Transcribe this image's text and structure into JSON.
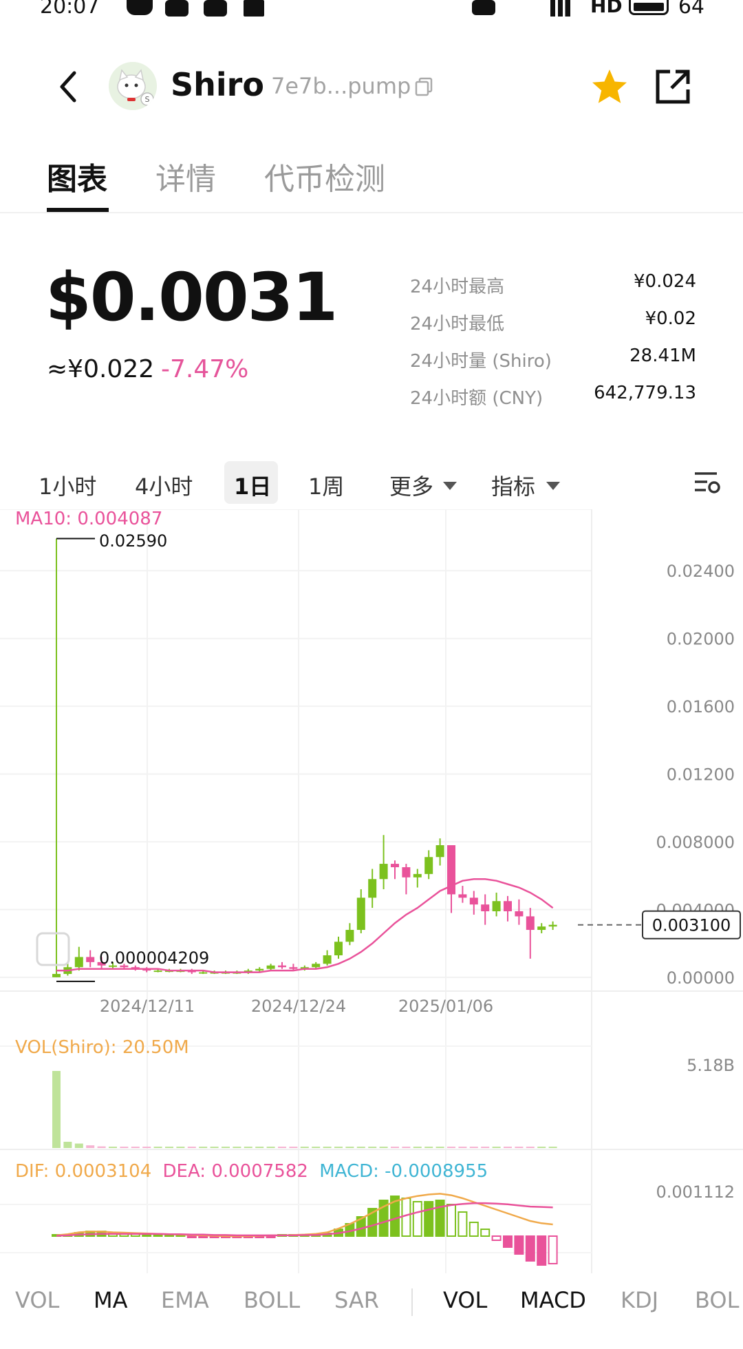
{
  "status_bar": {
    "time": "20:07",
    "network": "HD",
    "battery": "64"
  },
  "header": {
    "token_name": "Shiro",
    "token_address": "7e7b...pump"
  },
  "tabs": [
    {
      "label": "图表"
    },
    {
      "label": "详情"
    },
    {
      "label": "代币检测"
    }
  ],
  "price": {
    "usd": "$0.0031",
    "cny": "≈¥0.022",
    "change": "-7.47%",
    "stats": [
      {
        "label": "24小时最高",
        "value": "¥0.024"
      },
      {
        "label": "24小时最低",
        "value": "¥0.02"
      },
      {
        "label": "24小时量 (Shiro)",
        "value": "28.41M"
      },
      {
        "label": "24小时额 (CNY)",
        "value": "642,779.13"
      }
    ]
  },
  "timeframes": {
    "items": [
      "1小时",
      "4小时",
      "1日",
      "1周"
    ],
    "active": "1日",
    "more": "更多",
    "indicators": "指标"
  },
  "colors": {
    "up": "#7cc11e",
    "down": "#e9529a",
    "ma": "#e9529a",
    "dif": "#f0a94a",
    "macd": "#3fb5d4",
    "accent_star": "#f7b500"
  },
  "main_chart": {
    "ma_label": "MA10: 0.004087",
    "high_label": "0.02590",
    "low_label": "0.000004209",
    "current_label": "0.003100",
    "y_ticks": [
      "0.02400",
      "0.02000",
      "0.01600",
      "0.01200",
      "0.008000",
      "0.004000",
      "0.00000"
    ],
    "x_ticks": [
      "2024/12/11",
      "2024/12/24",
      "2025/01/06"
    ]
  },
  "vol_chart": {
    "label": "VOL(Shiro): 20.50M",
    "max_label": "5.18B"
  },
  "macd_chart": {
    "dif": "DIF: 0.0003104",
    "dea": "DEA: 0.0007582",
    "macd": "MACD: -0.0008955",
    "max_label": "0.001112"
  },
  "chart_data": {
    "type": "candlestick",
    "title": "",
    "y_range": [
      0,
      0.026
    ],
    "x_ticks": [
      "2024/12/11",
      "2024/12/24",
      "2025/01/06"
    ],
    "candles": [
      [
        4.2e-06,
        0.0259,
        4.2e-06,
        0.0002
      ],
      [
        0.0002,
        0.0009,
        0.0001,
        0.0006
      ],
      [
        0.0006,
        0.0018,
        0.0004,
        0.0012
      ],
      [
        0.0012,
        0.0016,
        0.0006,
        0.0009
      ],
      [
        0.0009,
        0.0012,
        0.0005,
        0.0007
      ],
      [
        0.0007,
        0.0009,
        0.0005,
        0.0007
      ],
      [
        0.0007,
        0.0008,
        0.0005,
        0.0006
      ],
      [
        0.0006,
        0.0007,
        0.0004,
        0.0005
      ],
      [
        0.0005,
        0.0006,
        0.0003,
        0.0004
      ],
      [
        0.0004,
        0.0005,
        0.0003,
        0.0004
      ],
      [
        0.0004,
        0.0005,
        0.0003,
        0.0004
      ],
      [
        0.0004,
        0.0005,
        0.0003,
        0.0004
      ],
      [
        0.0004,
        0.0005,
        0.0002,
        0.0003
      ],
      [
        0.0003,
        0.0004,
        0.0002,
        0.0003
      ],
      [
        0.0003,
        0.0004,
        0.0002,
        0.0003
      ],
      [
        0.0003,
        0.0004,
        0.0002,
        0.0003
      ],
      [
        0.0003,
        0.0004,
        0.0002,
        0.0003
      ],
      [
        0.0003,
        0.0005,
        0.0002,
        0.0004
      ],
      [
        0.0004,
        0.0006,
        0.0003,
        0.0005
      ],
      [
        0.0005,
        0.0008,
        0.0004,
        0.0007
      ],
      [
        0.0007,
        0.0009,
        0.0005,
        0.0006
      ],
      [
        0.0006,
        0.0008,
        0.0004,
        0.0005
      ],
      [
        0.0005,
        0.0007,
        0.0004,
        0.0006
      ],
      [
        0.0006,
        0.0009,
        0.0005,
        0.0008
      ],
      [
        0.0008,
        0.0016,
        0.0007,
        0.0013
      ],
      [
        0.0013,
        0.0024,
        0.0011,
        0.0021
      ],
      [
        0.0021,
        0.0032,
        0.0019,
        0.0028
      ],
      [
        0.0028,
        0.0052,
        0.0026,
        0.0047
      ],
      [
        0.0047,
        0.0064,
        0.0041,
        0.0058
      ],
      [
        0.0058,
        0.0084,
        0.0052,
        0.0067
      ],
      [
        0.0067,
        0.0069,
        0.0058,
        0.0065
      ],
      [
        0.0065,
        0.0067,
        0.0049,
        0.0059
      ],
      [
        0.0059,
        0.0064,
        0.0053,
        0.0061
      ],
      [
        0.0061,
        0.0075,
        0.0058,
        0.0071
      ],
      [
        0.0071,
        0.0082,
        0.0066,
        0.0078
      ],
      [
        0.0078,
        0.0078,
        0.0038,
        0.0049
      ],
      [
        0.0049,
        0.0054,
        0.0044,
        0.0047
      ],
      [
        0.0047,
        0.0051,
        0.0037,
        0.0043
      ],
      [
        0.0043,
        0.0049,
        0.0031,
        0.0039
      ],
      [
        0.0039,
        0.005,
        0.0036,
        0.0045
      ],
      [
        0.0045,
        0.0048,
        0.0033,
        0.0039
      ],
      [
        0.0039,
        0.0046,
        0.0031,
        0.0036
      ],
      [
        0.0036,
        0.0041,
        0.0011,
        0.0028
      ],
      [
        0.0028,
        0.0032,
        0.0026,
        0.003
      ],
      [
        0.003,
        0.0033,
        0.0028,
        0.0031
      ]
    ],
    "ma10": [
      0.0004,
      0.0004,
      0.0005,
      0.0005,
      0.0005,
      0.0005,
      0.0005,
      0.0005,
      0.0005,
      0.0005,
      0.0004,
      0.0004,
      0.0004,
      0.0004,
      0.0003,
      0.0003,
      0.0003,
      0.0003,
      0.0003,
      0.0004,
      0.0004,
      0.0004,
      0.0005,
      0.0005,
      0.0006,
      0.0008,
      0.0011,
      0.0015,
      0.002,
      0.0026,
      0.0032,
      0.0037,
      0.0041,
      0.0046,
      0.0051,
      0.0054,
      0.0057,
      0.0058,
      0.0058,
      0.0057,
      0.0055,
      0.0053,
      0.005,
      0.0046,
      0.0041
    ],
    "current": 0.0031,
    "volume": [
      5180,
      420,
      300,
      180,
      110,
      60,
      40,
      60,
      40,
      30,
      30,
      25,
      25,
      20,
      20,
      20,
      20,
      25,
      30,
      35,
      30,
      25,
      25,
      30,
      35,
      45,
      55,
      60,
      60,
      60,
      50,
      40,
      40,
      45,
      50,
      55,
      45,
      40,
      40,
      35,
      35,
      40,
      60,
      30,
      20
    ],
    "volume_unit": "M",
    "macd": {
      "hist": [
        1e-05,
        2e-05,
        5e-05,
        7e-05,
        7e-05,
        5e-05,
        4e-05,
        3e-05,
        2e-05,
        1.5e-05,
        1e-05,
        0.0,
        -1e-05,
        -1e-05,
        -2e-05,
        -2e-05,
        -2e-05,
        -2e-05,
        -1e-05,
        -1e-05,
        0.0,
        0.0,
        0.0,
        1e-05,
        4e-05,
        0.0001,
        0.00018,
        0.00028,
        0.0004,
        0.00052,
        0.00058,
        0.00055,
        0.0005,
        0.0005,
        0.00052,
        0.00046,
        0.00035,
        0.0002,
        0.0001,
        -6e-05,
        -0.00016,
        -0.00026,
        -0.00036,
        -0.00042,
        -0.0004
      ],
      "dif": [
        2e-05,
        5e-05,
        0.0001,
        0.00012,
        0.00012,
        0.0001,
        9e-05,
        8e-05,
        7e-05,
        6e-05,
        5e-05,
        4e-05,
        3e-05,
        2e-05,
        1e-05,
        0.0,
        0.0,
        0.0,
        1e-05,
        2e-05,
        2e-05,
        3e-05,
        4e-05,
        6e-05,
        0.0001,
        0.0002,
        0.00032,
        0.00046,
        0.00062,
        0.00078,
        0.00092,
        0.001,
        0.00106,
        0.0011,
        0.00112,
        0.00108,
        0.001,
        0.0009,
        0.0008,
        0.0007,
        0.0006,
        0.0005,
        0.0004,
        0.00034,
        0.00031
      ],
      "dea": [
        1e-05,
        2e-05,
        4e-05,
        5e-05,
        6e-05,
        6e-05,
        6e-05,
        6e-05,
        6e-05,
        6e-05,
        5e-05,
        5e-05,
        4e-05,
        4e-05,
        3e-05,
        3e-05,
        2e-05,
        2e-05,
        2e-05,
        2e-05,
        2e-05,
        2e-05,
        3e-05,
        3e-05,
        5e-05,
        8e-05,
        0.00013,
        0.0002,
        0.00028,
        0.00037,
        0.00046,
        0.00055,
        0.00063,
        0.0007,
        0.00077,
        0.00082,
        0.00085,
        0.00087,
        0.00087,
        0.00086,
        0.00084,
        0.00081,
        0.00078,
        0.00077,
        0.00076
      ]
    }
  },
  "bottom_tabs": {
    "main": [
      "VOL",
      "MA",
      "EMA",
      "BOLL",
      "SAR"
    ],
    "main_active": "MA",
    "sub": [
      "VOL",
      "MACD",
      "KDJ",
      "BOL"
    ],
    "sub_active": [
      "VOL",
      "MACD"
    ]
  }
}
